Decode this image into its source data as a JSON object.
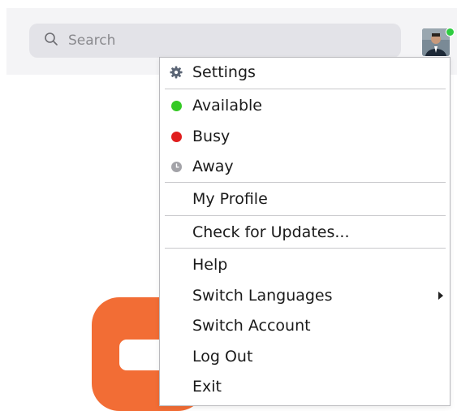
{
  "search": {
    "placeholder": "Search"
  },
  "colors": {
    "available": "#34c924",
    "busy": "#e01e1e",
    "away": "#a3a3a8",
    "brand": "#f26d35"
  },
  "menu": {
    "settings": "Settings",
    "available": "Available",
    "busy": "Busy",
    "away": "Away",
    "my_profile": "My Profile",
    "check_updates": "Check for Updates...",
    "help": "Help",
    "switch_languages": "Switch Languages",
    "switch_account": "Switch Account",
    "log_out": "Log Out",
    "exit": "Exit"
  },
  "icons": {
    "search": "search-icon",
    "settings": "gear-icon",
    "away": "clock-icon",
    "submenu": "chevron-right-icon"
  }
}
